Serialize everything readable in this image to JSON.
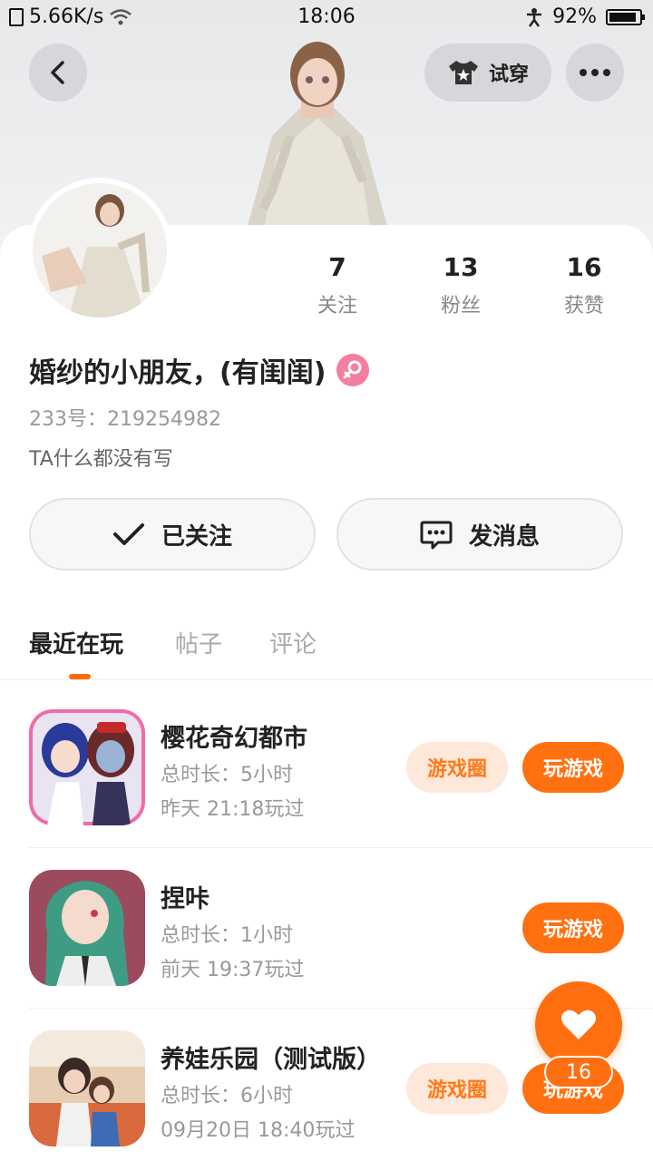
{
  "status_bar": {
    "network_speed": "5.66K/s",
    "time": "18:06",
    "battery": "92%",
    "battery_level": 0.92
  },
  "header": {
    "back_icon": "chevron-left-icon",
    "try_on_label": "试穿",
    "more_icon": "more-dots-icon"
  },
  "profile": {
    "stats": [
      {
        "value": "7",
        "label": "关注"
      },
      {
        "value": "13",
        "label": "粉丝"
      },
      {
        "value": "16",
        "label": "获赞"
      }
    ],
    "username": "婚纱的小朋友，(有闺闺)",
    "gender_icon": "female-icon",
    "uid": "233号：219254982",
    "bio": "TA什么都没有写",
    "follow_label": "已关注",
    "message_label": "发消息"
  },
  "tabs": [
    {
      "label": "最近在玩",
      "active": true
    },
    {
      "label": "帖子",
      "active": false
    },
    {
      "label": "评论",
      "active": false
    }
  ],
  "games": [
    {
      "name": "樱花奇幻都市",
      "duration": "总时长：5小时",
      "last_played": "昨天 21:18玩过",
      "circle_label": "游戏圈",
      "play_label": "玩游戏"
    },
    {
      "name": "捏咔",
      "duration": "总时长：1小时",
      "last_played": "前天 19:37玩过",
      "circle_label": "",
      "play_label": "玩游戏"
    },
    {
      "name": "养娃乐园（测试版）",
      "duration": "总时长：6小时",
      "last_played": "09月20日 18:40玩过",
      "circle_label": "游戏圈",
      "play_label": "玩游戏"
    }
  ],
  "fab": {
    "icon": "heart-icon",
    "count": "16"
  },
  "colors": {
    "accent": "#ff6f0f",
    "accent_light": "#fde8d9",
    "gender_pink": "#f47ea0"
  }
}
